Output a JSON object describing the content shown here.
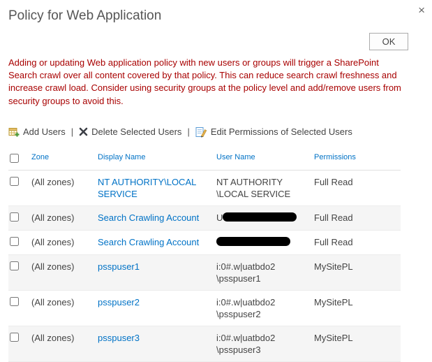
{
  "dialog": {
    "title": "Policy for Web Application",
    "close_icon": "×",
    "ok_label": "OK",
    "warning": "Adding or updating Web application policy with new users or groups will trigger a SharePoint Search crawl over all content covered by that policy. This can reduce search crawl freshness and increase crawl load. Consider using security groups at the policy level and add/remove users from security groups to avoid this."
  },
  "toolbar": {
    "separator": "|",
    "items": [
      {
        "label": "Add Users",
        "icon": "add-users-icon"
      },
      {
        "label": "Delete Selected Users",
        "icon": "delete-icon"
      },
      {
        "label": "Edit Permissions of Selected Users",
        "icon": "edit-permissions-icon"
      }
    ]
  },
  "table": {
    "headers": [
      "Zone",
      "Display Name",
      "User Name",
      "Permissions"
    ],
    "rows": [
      {
        "zone": "(All zones)",
        "display_name": "NT AUTHORITY\\LOCAL SERVICE",
        "user_name": "NT AUTHORITY\\LOCAL SERVICE",
        "permissions": "Full Read",
        "redacted": false
      },
      {
        "zone": "(All zones)",
        "display_name": "Search Crawling Account",
        "user_name": "U",
        "permissions": "Full Read",
        "redacted": true
      },
      {
        "zone": "(All zones)",
        "display_name": "Search Crawling Account",
        "user_name": "",
        "permissions": "Full Read",
        "redacted": true
      },
      {
        "zone": "(All zones)",
        "display_name": "psspuser1",
        "user_name": "i:0#.w|uatbdo2\\psspuser1",
        "permissions": "MySitePL",
        "redacted": false
      },
      {
        "zone": "(All zones)",
        "display_name": "psspuser2",
        "user_name": "i:0#.w|uatbdo2\\psspuser2",
        "permissions": "MySitePL",
        "redacted": false
      },
      {
        "zone": "(All zones)",
        "display_name": "psspuser3",
        "user_name": "i:0#.w|uatbdo2\\psspuser3",
        "permissions": "MySitePL",
        "redacted": false
      }
    ]
  },
  "colors": {
    "link_blue": "#0072c6",
    "warning_red": "#a80000",
    "alt_row_gray": "#f5f5f5",
    "redaction_black": "#000000"
  }
}
